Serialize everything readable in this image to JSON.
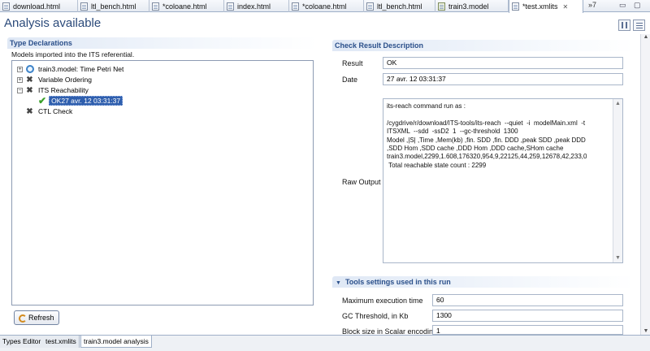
{
  "tabs": [
    {
      "label": "download.html",
      "active": false
    },
    {
      "label": "ltl_bench.html",
      "active": false
    },
    {
      "label": "*coloane.html",
      "active": false
    },
    {
      "label": "index.html",
      "active": false
    },
    {
      "label": "*coloane.html",
      "active": false
    },
    {
      "label": "ltl_bench.html",
      "active": false
    },
    {
      "label": "train3.model",
      "active": false
    },
    {
      "label": "*test.xmlits",
      "active": true
    }
  ],
  "tab_overflow": "»7",
  "title": "Analysis available",
  "type_declarations": {
    "heading": "Type Declarations",
    "description": "Models imported into the ITS referential.",
    "tree": [
      {
        "label": "train3.model: Time Petri Net",
        "icon": "clock-icon",
        "expander": "+"
      },
      {
        "label": "Variable Ordering",
        "icon": "cross-icon",
        "expander": "+"
      },
      {
        "label": "ITS Reachability",
        "icon": "cross-icon",
        "expander": "−"
      },
      {
        "label": "OK27 avr. 12 03:31:37",
        "icon": "check-icon",
        "selected": true
      },
      {
        "label": "CTL Check",
        "icon": "cross-icon"
      }
    ],
    "refresh_label": "Refresh"
  },
  "check_result": {
    "heading": "Check Result Description",
    "result_label": "Result",
    "result_value": "OK",
    "date_label": "Date",
    "date_value": "27 avr. 12 03:31:37",
    "raw_label": "Raw Output",
    "raw_output": "its-reach command run as :\n\n/cygdrive/r/download/ITS-tools/its-reach  --quiet  -i  modelMain.xml  -t\nITSXML  --sdd  -ssD2  1  --gc-threshold  1300\nModel ,|S| ,Time ,Mem(kb) ,fin. SDD ,fin. DDD ,peak SDD ,peak DDD\n,SDD Hom ,SDD cache ,DDD Hom ,DDD cache,SHom cache\ntrain3.model,2299,1.608,176320,954,9,22125,44,259,12678,42,233,0\n Total reachable state count : 2299"
  },
  "tools_settings": {
    "heading": "Tools settings used in this run",
    "items": [
      {
        "label": "Maximum execution time",
        "value": "60"
      },
      {
        "label": "GC Threshold, in Kb",
        "value": "1300"
      },
      {
        "label": "Block size in Scalar encoding",
        "value": "1"
      }
    ]
  },
  "bottom_tabs": [
    {
      "label": "Types Editor",
      "active": false
    },
    {
      "label": "test.xmlits",
      "active": false
    },
    {
      "label": "train3.model analysis",
      "active": true
    }
  ],
  "colors": {
    "accent": "#2a4f8a",
    "selection": "#2f5fae",
    "ok_check": "#3aa02a"
  }
}
